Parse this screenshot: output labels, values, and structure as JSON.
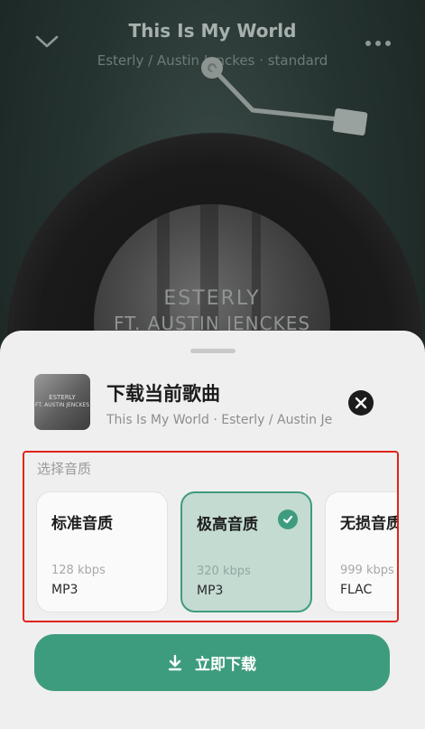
{
  "player": {
    "title": "This Is My World",
    "subtitle": "Esterly / Austin Jenckes · standard",
    "cover_line1": "ESTERLY",
    "cover_line2": "FT. AUSTIN JENCKES"
  },
  "sheet": {
    "title": "下载当前歌曲",
    "subtitle": "This Is My World · Esterly / Austin Jenckes",
    "thumb_line1": "ESTERLY",
    "thumb_line2": "FT. AUSTIN JENCKES",
    "quality_label": "选择音质",
    "qualities": [
      {
        "name": "标准音质",
        "rate": "128 kbps",
        "format": "MP3",
        "selected": false
      },
      {
        "name": "极高音质",
        "rate": "320 kbps",
        "format": "MP3",
        "selected": true
      },
      {
        "name": "无损音质",
        "rate": "999 kbps",
        "format": "FLAC",
        "selected": false
      }
    ],
    "download_label": "立即下载"
  },
  "icons": {
    "back": "chevron-down-icon",
    "more": "more-icon",
    "close": "close-icon",
    "check": "check-icon",
    "download": "download-icon"
  },
  "colors": {
    "accent": "#3e9c7e",
    "highlight_border": "#e0241b"
  }
}
